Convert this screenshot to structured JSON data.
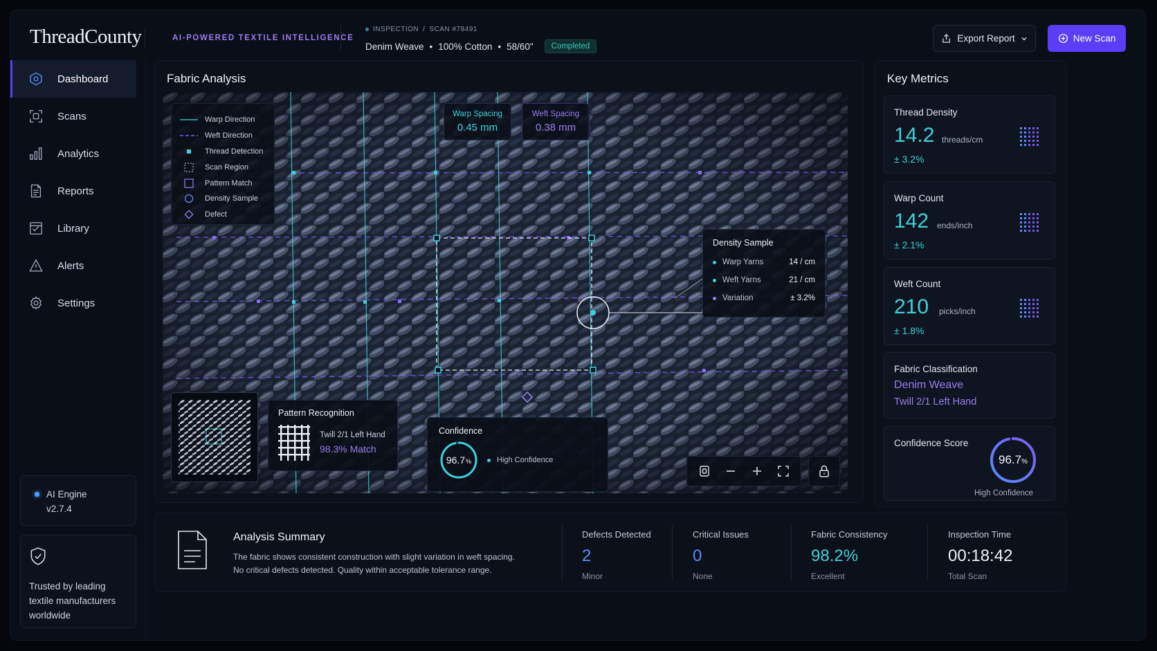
{
  "header": {
    "brand": "ThreadCounty",
    "tagline": "AI-POWERED TEXTILE INTELLIGENCE",
    "inspection_label": "INSPECTION",
    "scan_id": "SCAN #78491",
    "fabric_name": "Denim Weave",
    "material": "100% Cotton",
    "width": "58/60\"",
    "status": "Completed",
    "export_label": "Export Report",
    "new_scan_label": "New Scan"
  },
  "sidebar": {
    "items": [
      {
        "label": "Dashboard",
        "icon": "dashboard-icon",
        "active": true
      },
      {
        "label": "Scans",
        "icon": "scan-icon"
      },
      {
        "label": "Analytics",
        "icon": "analytics-icon"
      },
      {
        "label": "Reports",
        "icon": "reports-icon"
      },
      {
        "label": "Library",
        "icon": "library-icon"
      },
      {
        "label": "Alerts",
        "icon": "alerts-icon"
      },
      {
        "label": "Settings",
        "icon": "gear-icon"
      }
    ],
    "engine_name": "AI Engine",
    "engine_version": "v2.7.4",
    "trust_text": "Trusted by leading textile manufacturers worldwide"
  },
  "fabric": {
    "title": "Fabric Analysis",
    "legend": [
      "Warp Direction",
      "Weft Direction",
      "Thread Detection",
      "Scan Region",
      "Pattern Match",
      "Density Sample",
      "Defect"
    ],
    "warp_spacing_label": "Warp Spacing",
    "warp_spacing_value": "0.45 mm",
    "weft_spacing_label": "Weft Spacing",
    "weft_spacing_value": "0.38 mm",
    "density": {
      "title": "Density Sample",
      "rows": [
        {
          "label": "Warp Yarns",
          "value": "14 / cm",
          "color": "#3fd0da"
        },
        {
          "label": "Weft Yarns",
          "value": "21 / cm",
          "color": "#3fd0da"
        },
        {
          "label": "Variation",
          "value": "± 3.2%",
          "color": "#9d7cf0"
        }
      ]
    },
    "pattern": {
      "title": "Pattern Recognition",
      "name": "Twill 2/1 Left Hand",
      "match": "98.3% Match"
    },
    "confidence": {
      "title": "Confidence",
      "value": "96.7",
      "unit": "%",
      "fraction": 0.967,
      "label": "High Confidence"
    }
  },
  "metrics": {
    "title": "Key Metrics",
    "thread_density": {
      "label": "Thread Density",
      "value": "14.2",
      "unit": "threads/cm",
      "delta": "± 3.2%"
    },
    "warp_count": {
      "label": "Warp Count",
      "value": "142",
      "unit": "ends/inch",
      "delta": "± 2.1%"
    },
    "weft_count": {
      "label": "Weft Count",
      "value": "210",
      "unit": "picks/inch",
      "delta": "± 1.8%"
    },
    "classification": {
      "label": "Fabric Classification",
      "primary": "Denim Weave",
      "secondary": "Twill 2/1 Left Hand"
    },
    "confidence_score": {
      "label": "Confidence Score",
      "value": "96.7",
      "unit": "%",
      "fraction": 0.967,
      "caption": "High Confidence"
    }
  },
  "summary": {
    "title": "Analysis Summary",
    "line1": "The fabric shows consistent construction with slight variation in weft spacing.",
    "line2": "No critical defects detected. Quality within acceptable tolerance range.",
    "stats": [
      {
        "label": "Defects Detected",
        "value": "2",
        "sub": "Minor",
        "color": "#5b8cff"
      },
      {
        "label": "Critical Issues",
        "value": "0",
        "sub": "None",
        "color": "#5b8cff"
      },
      {
        "label": "Fabric Consistency",
        "value": "98.2%",
        "sub": "Excellent",
        "color": "#3fd0da"
      },
      {
        "label": "Inspection Time",
        "value": "00:18:42",
        "sub": "Total Scan",
        "color": "#eef0f5"
      }
    ]
  },
  "colors": {
    "accent": "#5b3df5",
    "cyan": "#3fd0da",
    "purple": "#9d7cf0"
  }
}
